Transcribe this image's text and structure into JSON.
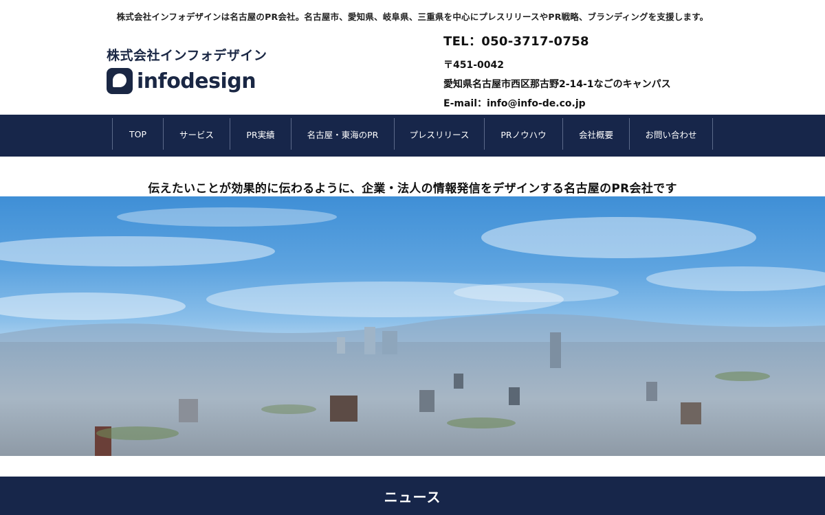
{
  "header": {
    "tagline": "株式会社インフォデザインは名古屋のPR会社。名古屋市、愛知県、岐阜県、三重県を中心にプレスリリースやPR戦略、ブランディングを支援します。",
    "logo_company": "株式会社インフォデザイン",
    "logo_word": "infodesign",
    "tel": "TEL：050-3717-0758",
    "postal": "〒451-0042",
    "address": "愛知県名古屋市西区那古野2-14-1なごのキャンパス",
    "email": "E-mail：info@info-de.co.jp"
  },
  "nav": {
    "items": [
      {
        "label": "TOP"
      },
      {
        "label": "サービス"
      },
      {
        "label": "PR実績"
      },
      {
        "label": "名古屋・東海のPR"
      },
      {
        "label": "プレスリリース"
      },
      {
        "label": "PRノウハウ"
      },
      {
        "label": "会社概要"
      },
      {
        "label": "お問い合わせ"
      }
    ]
  },
  "main": {
    "catch_copy": "伝えたいことが効果的に伝わるように、企業・法人の情報発信をデザインする名古屋のPR会社です",
    "news_heading": "ニュース"
  },
  "colors": {
    "navy": "#17264a",
    "logo": "#1a2744",
    "sky_top": "#3f8fd6"
  }
}
